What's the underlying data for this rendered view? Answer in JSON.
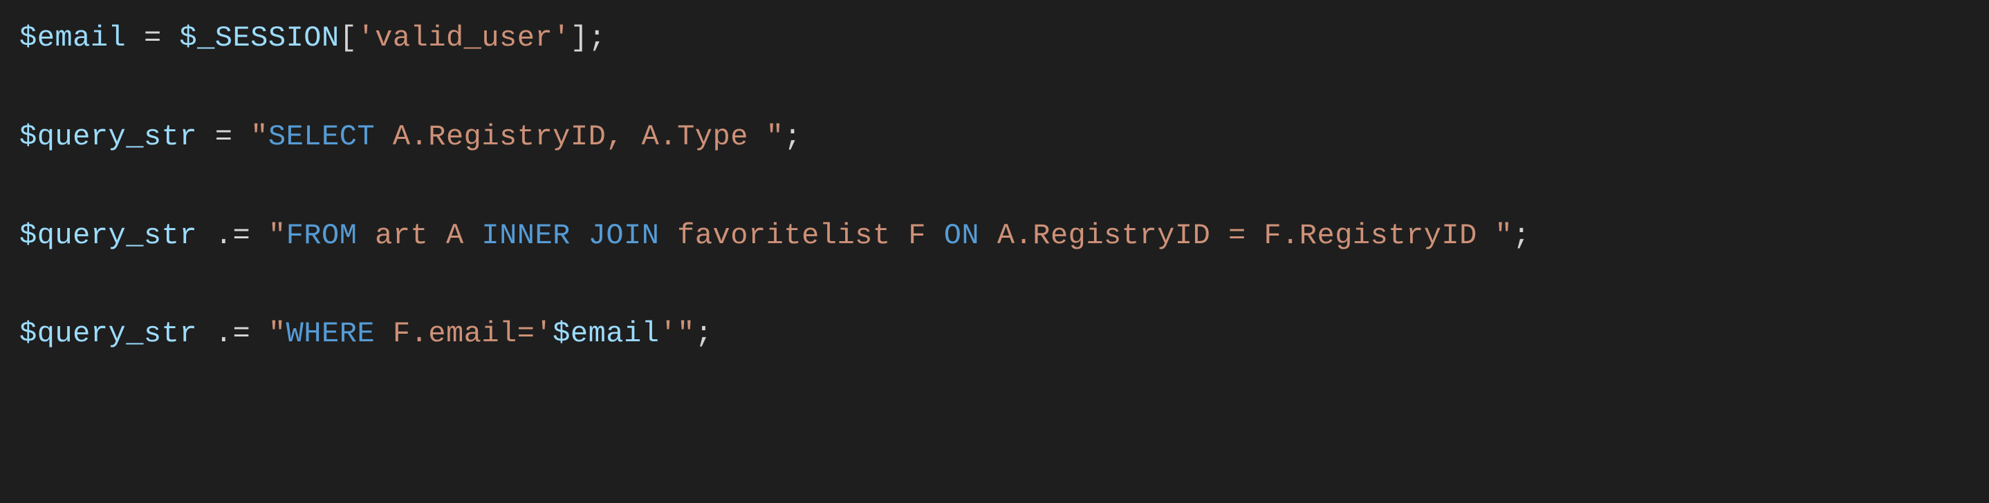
{
  "code": {
    "line1": {
      "var_email": "$email",
      "eq": " = ",
      "var_session": "$_SESSION",
      "lbrack": "[",
      "key": "'valid_user'",
      "rbrack": "]",
      "semi": ";"
    },
    "line3": {
      "var_query": "$query_str",
      "eq": " = ",
      "q_open": "\"",
      "kw_select": "SELECT",
      "rest": " A.RegistryID, A.Type ",
      "q_close": "\"",
      "semi": ";"
    },
    "line5": {
      "var_query": "$query_str",
      "concat": " .= ",
      "q_open": "\"",
      "kw_from": "FROM",
      "between1": " art A ",
      "kw_inner": "INNER",
      "space1": " ",
      "kw_join": "JOIN",
      "between2": " favoritelist F ",
      "kw_on": "ON",
      "tail": " A.RegistryID = F.RegistryID ",
      "q_close": "\"",
      "semi": ";"
    },
    "line7": {
      "var_query": "$query_str",
      "concat": " .= ",
      "q_open": "\"",
      "kw_where": "WHERE",
      "between": " F.email='",
      "var_email": "$email",
      "tail": "'",
      "q_close": "\"",
      "semi": ";"
    }
  },
  "chart_data": {
    "type": "table",
    "title": "PHP source snippet",
    "lines": [
      "$email = $_SESSION['valid_user'];",
      "",
      "$query_str = \"SELECT A.RegistryID, A.Type \";",
      "",
      "$query_str .= \"FROM art A INNER JOIN favoritelist F ON A.RegistryID = F.RegistryID \";",
      "",
      "$query_str .= \"WHERE F.email='$email'\";"
    ]
  }
}
